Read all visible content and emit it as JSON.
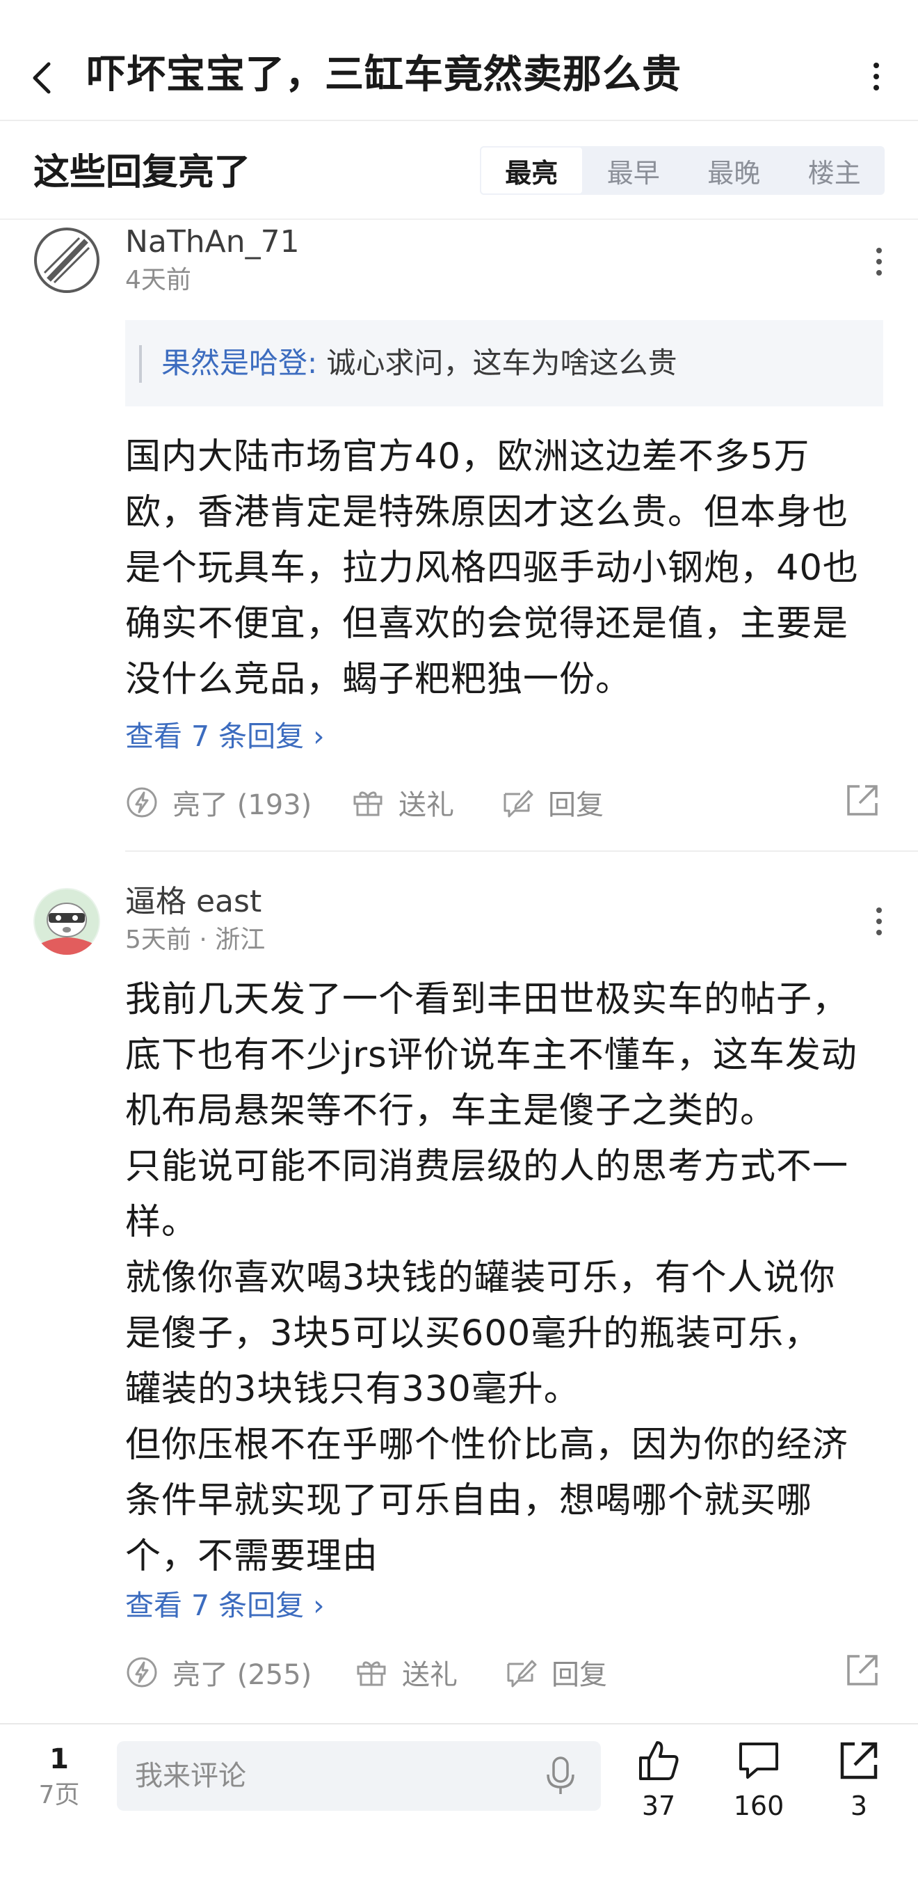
{
  "header": {
    "title": "吓坏宝宝了，三缸车竟然卖那么贵"
  },
  "sort": {
    "section_title": "这些回复亮了",
    "tabs": [
      "最亮",
      "最早",
      "最晚",
      "楼主"
    ],
    "active_tab": "最亮"
  },
  "comments": [
    {
      "username": "NaThAn_71",
      "time": "4天前",
      "quote": {
        "author": "果然是哈登:",
        "text": " 诚心求问，这车为啥这么贵"
      },
      "body": "国内大陆市场官方40，欧洲这边差不多5万\n欧，香港肯定是特殊原因才这么贵。但本身也\n是个玩具车，拉力风格四驱手动小钢炮，40也\n确实不便宜，但喜欢的会觉得还是值，主要是\n没什么竞品，蝎子粑粑独一份。",
      "view_replies": "查看 7 条回复 ›",
      "likes": "亮了 (193)",
      "gift": "送礼",
      "reply": "回复"
    },
    {
      "username": "逼格 east",
      "time": "5天前 · 浙江",
      "body": "我前几天发了一个看到丰田世极实车的帖子，\n底下也有不少jrs评价说车主不懂车，这车发动\n机布局悬架等不行，车主是傻子之类的。\n只能说可能不同消费层级的人的思考方式不一\n样。\n就像你喜欢喝3块钱的罐装可乐，有个人说你\n是傻子，3块5可以买600毫升的瓶装可乐，\n罐装的3块钱只有330毫升。\n但你压根不在乎哪个性价比高，因为你的经济\n条件早就实现了可乐自由，想喝哪个就买哪\n个，不需要理由",
      "view_replies": "查看 7 条回复 ›",
      "likes": "亮了 (255)",
      "gift": "送礼",
      "reply": "回复"
    }
  ],
  "bottom_bar": {
    "page_current": "1",
    "page_total": "7页",
    "comment_placeholder": "我来评论",
    "like_count": "37",
    "comment_count": "160",
    "share_count": "3"
  },
  "colors": {
    "link": "#3c6cbf",
    "muted": "#8c8c8c",
    "tab_bg": "#eef1f7"
  },
  "icons": [
    "back-arrow-icon",
    "more-vertical-icon",
    "lightning-icon",
    "gift-icon",
    "edit-reply-icon",
    "share-icon",
    "mic-icon",
    "thumbs-up-icon",
    "chat-bubble-icon"
  ]
}
